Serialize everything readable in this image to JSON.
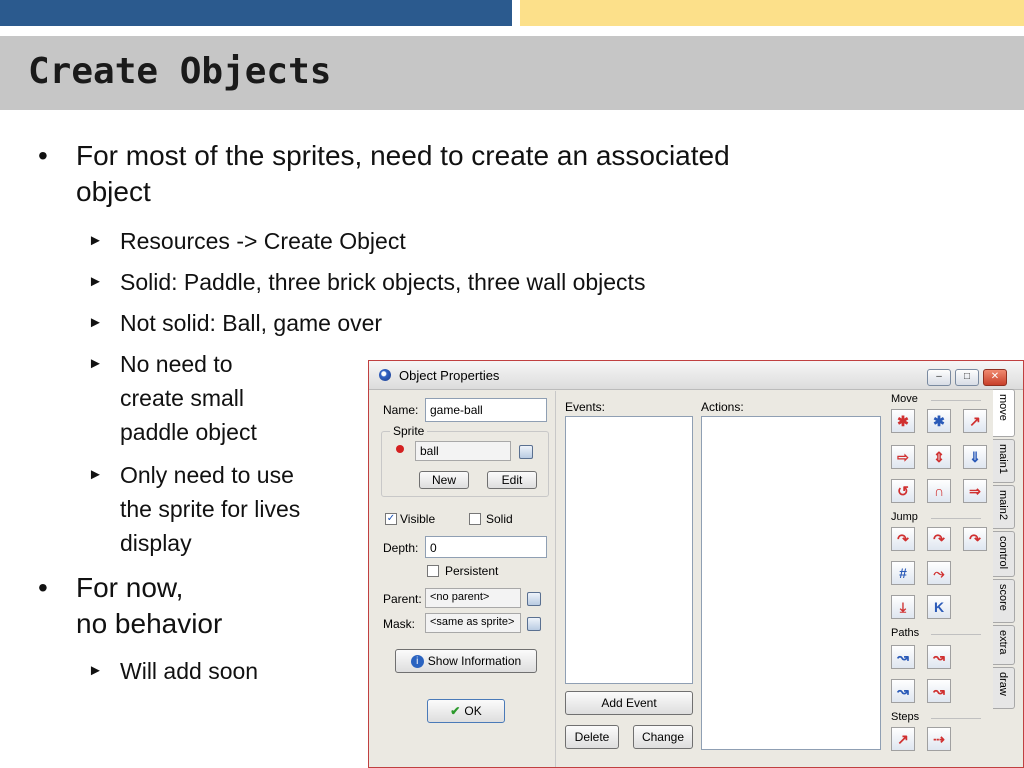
{
  "slide": {
    "title": "Create Objects",
    "bullets": [
      {
        "line1": "For most of the sprites, need to create an associated",
        "line2": "object"
      },
      {
        "line1": "For now,",
        "line2": "no behavior"
      }
    ],
    "sub_bullets": [
      "Resources -> Create Object",
      "Solid: Paddle, three brick objects, three wall objects",
      "Not solid: Ball, game over",
      [
        "No need to",
        "create small",
        "paddle object"
      ],
      [
        "Only need to use",
        "the sprite for lives",
        "display"
      ],
      "Will add soon"
    ],
    "bullet_glyph": "•",
    "sub_glyph": "►"
  },
  "dialog": {
    "title": "Object Properties",
    "name_label": "Name:",
    "name_value": "game-ball",
    "sprite_group": "Sprite",
    "sprite_value": "ball",
    "new_button": "New",
    "edit_button": "Edit",
    "visible_label": "Visible",
    "visible_checked": true,
    "solid_label": "Solid",
    "solid_checked": false,
    "depth_label": "Depth:",
    "depth_value": "0",
    "persistent_label": "Persistent",
    "parent_label": "Parent:",
    "parent_value": "<no parent>",
    "mask_label": "Mask:",
    "mask_value": "<same as sprite>",
    "show_info_button": "Show Information",
    "ok_button": "OK",
    "events_label": "Events:",
    "actions_label": "Actions:",
    "add_event_button": "Add Event",
    "delete_button": "Delete",
    "change_button": "Change",
    "sections": [
      "Move",
      "Jump",
      "Paths",
      "Steps"
    ],
    "tabs": [
      "move",
      "main1",
      "main2",
      "control",
      "score",
      "extra",
      "draw"
    ],
    "window_buttons": {
      "minimize": "–",
      "maximize": "□",
      "close": "✕"
    }
  },
  "colors": {
    "top_bar_blue": "#2b5a8e",
    "top_bar_yellow": "#fce08a",
    "title_band": "#c6c6c6"
  }
}
